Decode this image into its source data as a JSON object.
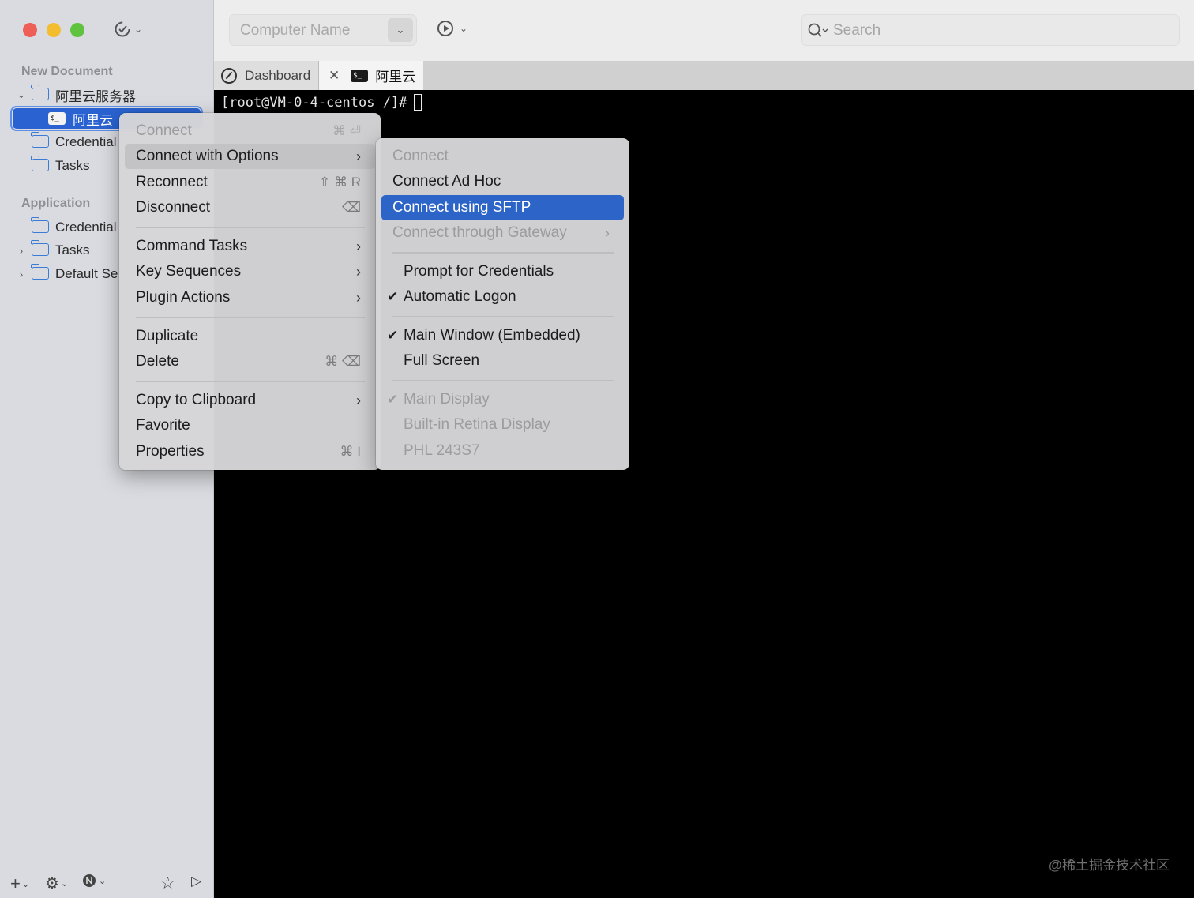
{
  "toolbar": {
    "computer_name_placeholder": "Computer Name",
    "search_placeholder": "Search"
  },
  "tabs": [
    {
      "label": "Dashboard",
      "icon": "dashboard-icon"
    },
    {
      "label": "阿里云",
      "icon": "terminal-icon"
    }
  ],
  "sidebar": {
    "section1": "New Document",
    "section2": "Application",
    "items": [
      {
        "label": "阿里云服务器",
        "icon": "folder-icon"
      },
      {
        "label": "阿里云",
        "icon": "terminal-icon"
      },
      {
        "label": "Credential",
        "icon": "folder-icon"
      },
      {
        "label": "Tasks",
        "icon": "folder-icon"
      },
      {
        "label": "Credential",
        "icon": "folder-icon"
      },
      {
        "label": "Tasks",
        "icon": "folder-icon"
      },
      {
        "label": "Default Se",
        "icon": "folder-icon"
      }
    ]
  },
  "terminal": {
    "prompt": "[root@VM-0-4-centos /]#"
  },
  "watermark": "@稀土掘金技术社区",
  "context_menu": {
    "items": [
      {
        "label": "Connect",
        "shortcut": "⌘ ⏎"
      },
      {
        "label": "Connect with Options"
      },
      {
        "label": "Reconnect",
        "shortcut": "⇧ ⌘ R"
      },
      {
        "label": "Disconnect",
        "shortcut": "⌫"
      },
      {
        "label": "Command Tasks"
      },
      {
        "label": "Key Sequences"
      },
      {
        "label": "Plugin Actions"
      },
      {
        "label": "Duplicate"
      },
      {
        "label": "Delete",
        "shortcut": "⌘ ⌫"
      },
      {
        "label": "Copy to Clipboard"
      },
      {
        "label": "Favorite"
      },
      {
        "label": "Properties",
        "shortcut": "⌘ I"
      }
    ]
  },
  "submenu": {
    "items": [
      {
        "label": "Connect"
      },
      {
        "label": "Connect Ad Hoc"
      },
      {
        "label": "Connect using SFTP"
      },
      {
        "label": "Connect through Gateway"
      },
      {
        "label": "Prompt for Credentials"
      },
      {
        "label": "Automatic Logon"
      },
      {
        "label": "Main Window (Embedded)"
      },
      {
        "label": "Full Screen"
      },
      {
        "label": "Main Display"
      },
      {
        "label": "Built-in Retina Display"
      },
      {
        "label": "PHL 243S7"
      }
    ]
  },
  "colors": {
    "accent": "#2d64c8",
    "sidebar_bg": "#d9dbe0",
    "terminal_bg": "#000000",
    "folder": "#3a7bd5"
  }
}
